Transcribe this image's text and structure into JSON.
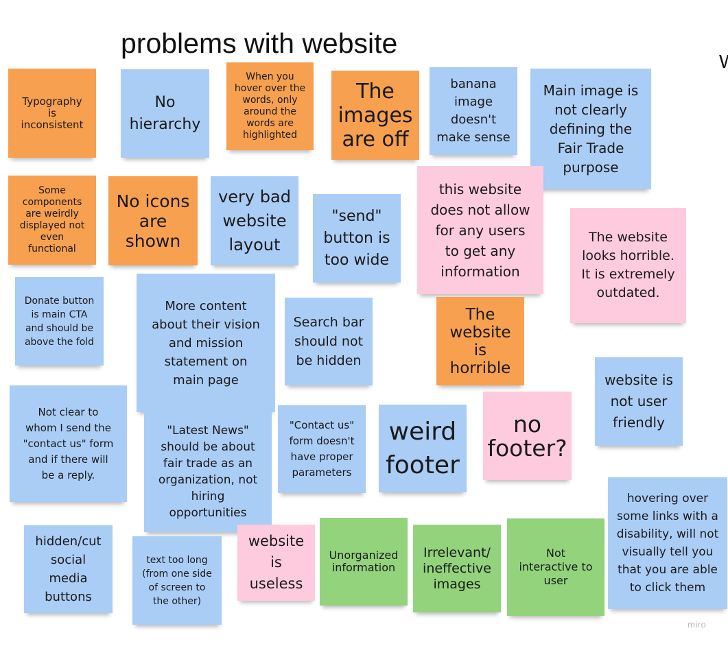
{
  "board": {
    "title": "problems with website",
    "edge_letter": "W",
    "watermark": "miro"
  },
  "note_colors": {
    "orange": "#f7a04f",
    "blue": "#aacdf6",
    "pink": "#fdcbdd",
    "green": "#93d37c"
  },
  "notes": [
    {
      "text": "Typography\nis\ninconsistent",
      "color": "orange"
    },
    {
      "text": "No\nhierarchy",
      "color": "blue"
    },
    {
      "text": "When you\nhover over the\nwords, only\naround the\nwords are\nhighlighted",
      "color": "orange"
    },
    {
      "text": "The\nimages\nare off",
      "color": "orange"
    },
    {
      "text": "banana\nimage\ndoesn't\nmake sense",
      "color": "blue"
    },
    {
      "text": "Main image is\nnot clearly\ndefining the\nFair Trade\npurpose",
      "color": "blue"
    },
    {
      "text": "Some\ncomponents\nare weirdly\ndisplayed not\neven\nfunctional",
      "color": "orange"
    },
    {
      "text": "No icons\nare\nshown",
      "color": "orange"
    },
    {
      "text": "very bad\nwebsite\nlayout",
      "color": "blue"
    },
    {
      "text": "\"send\"\nbutton is\ntoo wide",
      "color": "blue"
    },
    {
      "text": "this website\ndoes not allow\nfor any users\nto get any\ninformation",
      "color": "pink"
    },
    {
      "text": "The website\nlooks horrible.\nIt is extremely\noutdated.",
      "color": "pink"
    },
    {
      "text": "Donate button\nis main CTA\nand should be\nabove the fold",
      "color": "blue"
    },
    {
      "text": "More content\nabout their vision\nand mission\nstatement on\nmain page",
      "color": "blue"
    },
    {
      "text": "Search bar\nshould not\nbe hidden",
      "color": "blue"
    },
    {
      "text": "The\nwebsite\nis\nhorrible",
      "color": "orange"
    },
    {
      "text": "website is\nnot user\nfriendly",
      "color": "blue"
    },
    {
      "text": "Not clear to\nwhom I send the\n\"contact us\" form\nand if there will\nbe a reply.",
      "color": "blue"
    },
    {
      "text": "\"Latest News\"\nshould be about\nfair trade as an\norganization, not\nhiring\nopportunities",
      "color": "blue"
    },
    {
      "text": "\"Contact us\"\nform doesn't\nhave proper\nparameters",
      "color": "blue"
    },
    {
      "text": "weird\nfooter",
      "color": "blue"
    },
    {
      "text": "no\nfooter?",
      "color": "pink"
    },
    {
      "text": "hovering over\nsome links with a\ndisability, will not\nvisually tell you\nthat you are able\nto click them",
      "color": "blue"
    },
    {
      "text": "hidden/cut\nsocial\nmedia\nbuttons",
      "color": "blue"
    },
    {
      "text": "text too long\n(from one side\nof screen to\nthe other)",
      "color": "blue"
    },
    {
      "text": "website\nis\nuseless",
      "color": "pink"
    },
    {
      "text": "Unorganized\ninformation",
      "color": "green"
    },
    {
      "text": "Irrelevant/\nineffective\nimages",
      "color": "green"
    },
    {
      "text": "Not\ninteractive to\nuser",
      "color": "green"
    }
  ]
}
